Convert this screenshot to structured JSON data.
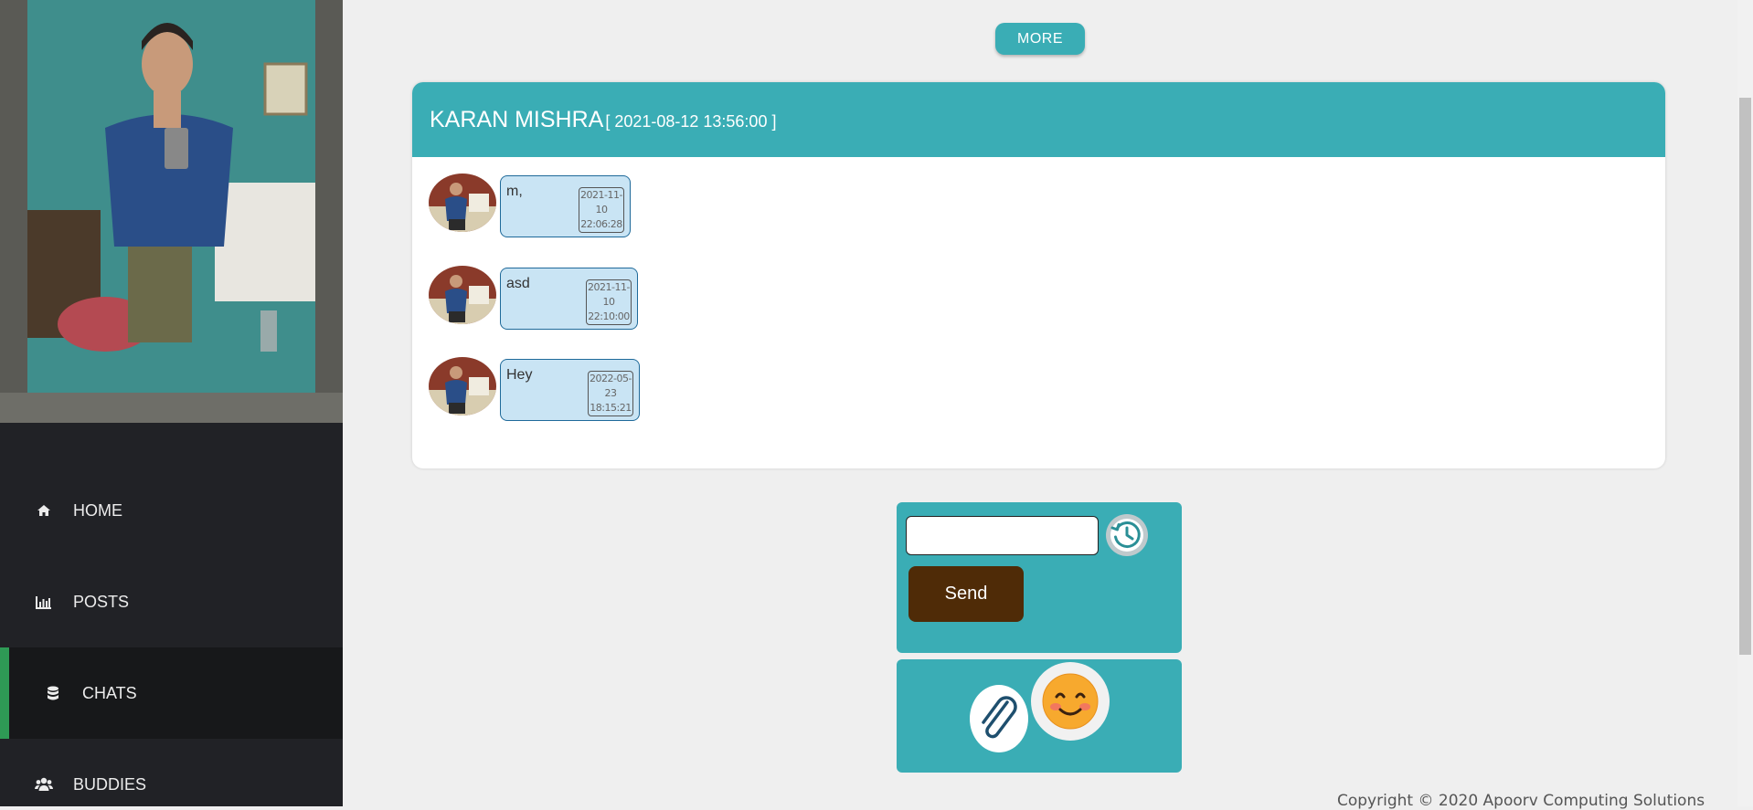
{
  "sidebar": {
    "photo_alt": "Profile photo",
    "items": [
      {
        "label": "HOME",
        "icon": "home-icon"
      },
      {
        "label": "POSTS",
        "icon": "bar-chart-icon"
      },
      {
        "label": "CHATS",
        "icon": "database-icon",
        "active": true
      },
      {
        "label": "BUDDIES",
        "icon": "users-icon"
      }
    ]
  },
  "more_button": "MORE",
  "chat": {
    "name": "KARAN MISHRA",
    "date": "[ 2021-08-12 13:56:00 ]",
    "messages": [
      {
        "text": "m,",
        "time_date": "2021-11-10",
        "time_clock": "22:06:28"
      },
      {
        "text": "asd",
        "time_date": "2021-11-10",
        "time_clock": "22:10:00"
      },
      {
        "text": "Hey",
        "time_date": "2022-05-23",
        "time_clock": "18:15:21"
      }
    ]
  },
  "compose": {
    "input_value": "",
    "send_label": "Send"
  },
  "footer": {
    "copyright": "Copyright © 2020 Apoorv Computing Solutions"
  },
  "colors": {
    "accent": "#3aadb5",
    "sidebar": "#212226",
    "active_marker": "#2e9a55",
    "send_button": "#4f2b07",
    "bubble": "#c9e4f4"
  }
}
